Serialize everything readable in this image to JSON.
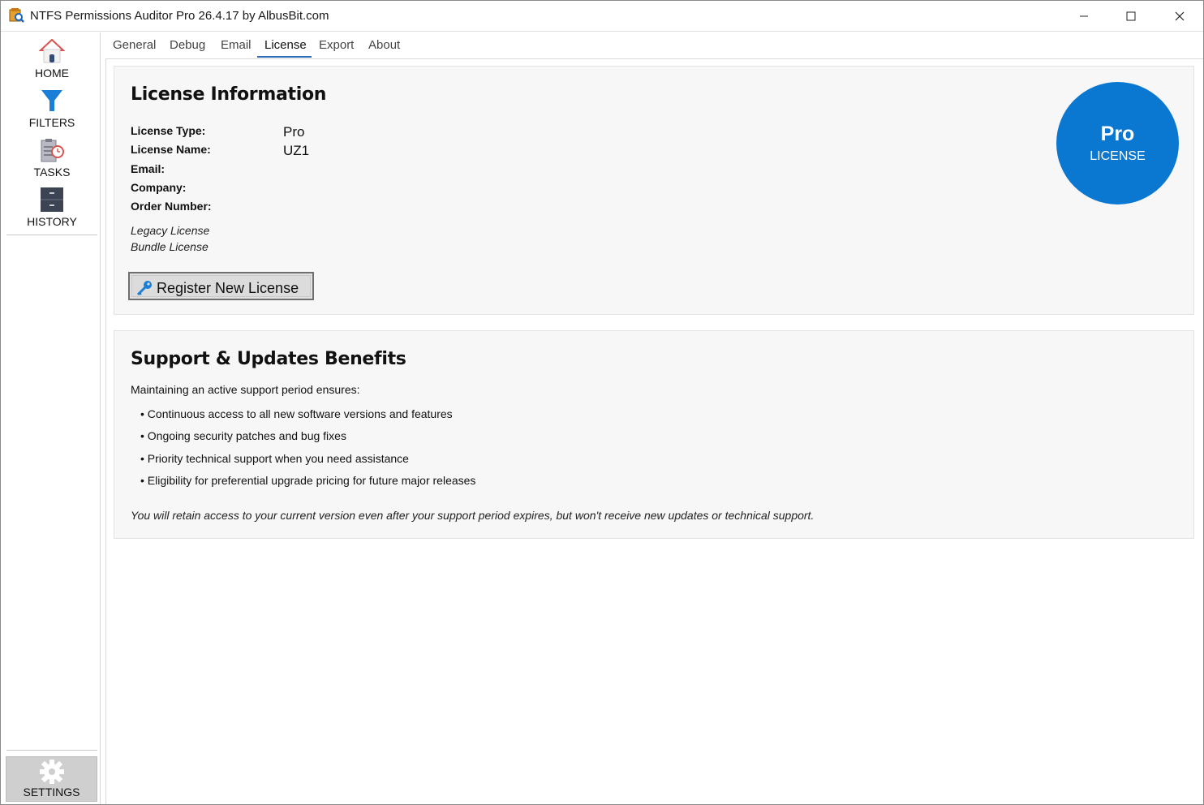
{
  "window": {
    "title": "NTFS Permissions Auditor Pro 26.4.17 by AlbusBit.com"
  },
  "sidebar": {
    "items": [
      {
        "label": "HOME",
        "icon": "home-icon"
      },
      {
        "label": "FILTERS",
        "icon": "filter-icon"
      },
      {
        "label": "TASKS",
        "icon": "tasks-icon"
      },
      {
        "label": "HISTORY",
        "icon": "history-icon"
      }
    ],
    "settings": {
      "label": "SETTINGS",
      "icon": "gear-icon"
    }
  },
  "tabs": [
    {
      "label": "General"
    },
    {
      "label": "Debug"
    },
    {
      "label": "Email"
    },
    {
      "label": "License",
      "active": true
    },
    {
      "label": "Export"
    },
    {
      "label": "About"
    }
  ],
  "license": {
    "heading": "License Information",
    "fields": [
      {
        "label": "License Type:",
        "value": "Pro"
      },
      {
        "label": "License Name:",
        "value": "UZ1"
      },
      {
        "label": "Email:",
        "value": ""
      },
      {
        "label": "Company:",
        "value": ""
      },
      {
        "label": "Order Number:",
        "value": ""
      }
    ],
    "notes": [
      "Legacy License",
      "Bundle License"
    ],
    "register_button": "Register New License",
    "badge": {
      "title": "Pro",
      "subtitle": "LICENSE",
      "color": "#0a77d1"
    }
  },
  "support": {
    "heading": "Support & Updates Benefits",
    "intro": "Maintaining an active support period ensures:",
    "bullets": [
      "• Continuous access to all new software versions and features",
      "• Ongoing security patches and bug fixes",
      "• Priority technical support when you need assistance",
      "• Eligibility for preferential upgrade pricing for future major releases"
    ],
    "note": "You will retain access to your current version even after your support period expires, but won't receive new updates or technical support."
  },
  "colors": {
    "accent": "#2a6cc4",
    "badge": "#0a77d1"
  }
}
